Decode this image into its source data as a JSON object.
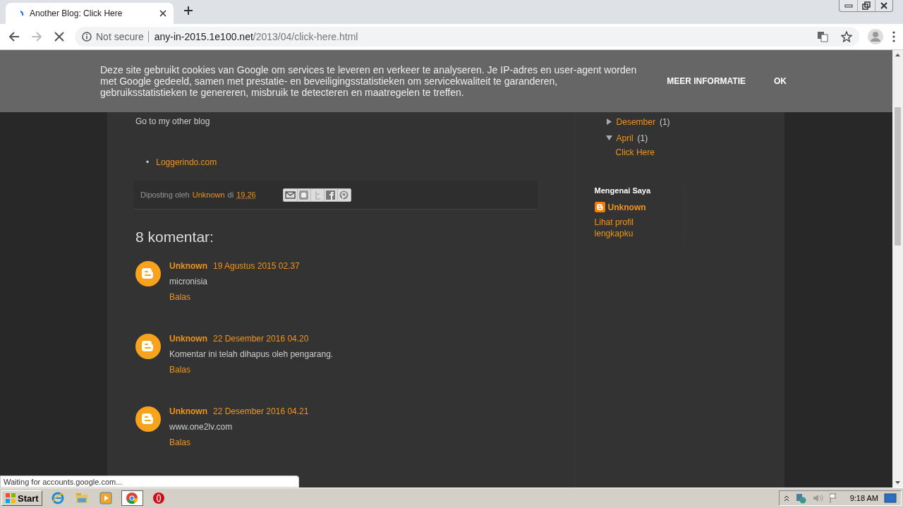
{
  "browser": {
    "tab": {
      "title": "Another Blog: Click Here",
      "selected": true
    },
    "address": {
      "security": "Not secure",
      "host": "any-in-2015.1e100.net",
      "path": "/2013/04/click-here.html"
    }
  },
  "cookie_banner": {
    "text": "Deze site gebruikt cookies van Google om services te leveren en verkeer te analyseren. Je IP-adres en user-agent worden met Google gedeeld, samen met prestatie- en beveiligingsstatistieken om servicekwaliteit te garanderen, gebruiksstatistieken te genereren, misbruik te detecteren en maatregelen te treffen.",
    "buttons": [
      "MEER INFORMATIE",
      "OK"
    ]
  },
  "post": {
    "intro": "Go to my other blog",
    "links": [
      {
        "bullet": "•",
        "text": "Loggerindo.com"
      }
    ],
    "footer": {
      "prefix": "Diposting oleh",
      "author": "Unknown",
      "at": "di",
      "time": "19.26"
    }
  },
  "comments": {
    "heading": "8 komentar:",
    "items": [
      {
        "author": "Unknown",
        "date": "19 Agustus 2015 02.37",
        "text": "micronisia",
        "reply": "Balas"
      },
      {
        "author": "Unknown",
        "date": "22 Desember 2016 04.20",
        "text": "Komentar ini telah dihapus oleh pengarang.",
        "reply": "Balas"
      },
      {
        "author": "Unknown",
        "date": "22 Desember 2016 04.21",
        "text": "www.one2lv.com",
        "reply": "Balas"
      }
    ]
  },
  "sidebar": {
    "archive": [
      {
        "label": "Desember",
        "count": "(1)",
        "expanded": false
      },
      {
        "label": "April",
        "count": "(1)",
        "expanded": true,
        "children": [
          {
            "label": "Click Here"
          }
        ]
      }
    ],
    "profile": {
      "title": "Mengenai Saya",
      "name": "Unknown",
      "link": "Lihat profil lengkapku"
    }
  },
  "status_bar": "Waiting for accounts.google.com...",
  "taskbar": {
    "start": "Start",
    "apps": [
      {
        "kind": "ie",
        "selected": false
      },
      {
        "kind": "explorer",
        "selected": false
      },
      {
        "kind": "media",
        "selected": false
      },
      {
        "kind": "chrome",
        "selected": true
      },
      {
        "kind": "opera",
        "selected": false
      }
    ],
    "time": "9:18 AM"
  }
}
